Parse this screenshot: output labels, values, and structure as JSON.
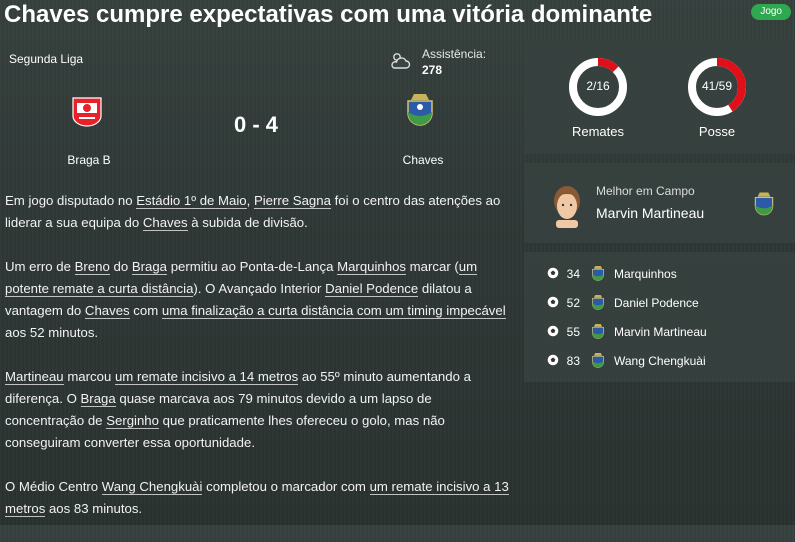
{
  "headline": "Chaves cumpre expectativas com uma vitória dominante",
  "tag": "Jogo",
  "match": {
    "competition": "Segunda Liga",
    "attendance_label": "Assistência:",
    "attendance_value": "278",
    "home_team": "Braga B",
    "away_team": "Chaves",
    "score": "0 - 4",
    "weather_icon": "cloud-icon"
  },
  "article": {
    "p1": [
      {
        "t": "Em jogo disputado no "
      },
      {
        "t": "Estádio 1º de Maio",
        "link": true
      },
      {
        "t": ", "
      },
      {
        "t": "Pierre Sagna",
        "link": true
      },
      {
        "t": " foi o centro das atenções ao liderar a sua equipa do "
      },
      {
        "t": "Chaves",
        "link": true
      },
      {
        "t": " à subida de divisão."
      }
    ],
    "p2": [
      {
        "t": "Um erro de "
      },
      {
        "t": "Breno",
        "link": true
      },
      {
        "t": " do "
      },
      {
        "t": "Braga",
        "link": true
      },
      {
        "t": " permitiu ao Ponta-de-Lança "
      },
      {
        "t": "Marquinhos",
        "link": true
      },
      {
        "t": " marcar ("
      },
      {
        "t": "um potente remate a curta distância",
        "link": true
      },
      {
        "t": "). O Avançado Interior "
      },
      {
        "t": "Daniel Podence",
        "link": true
      },
      {
        "t": " dilatou a vantagem do "
      },
      {
        "t": "Chaves",
        "link": true
      },
      {
        "t": " com "
      },
      {
        "t": "uma finalização a curta distância com um timing impecável",
        "link": true
      },
      {
        "t": " aos 52 minutos."
      }
    ],
    "p3": [
      {
        "t": "Martineau",
        "link": true
      },
      {
        "t": " marcou "
      },
      {
        "t": "um remate incisivo a 14 metros",
        "link": true
      },
      {
        "t": " ao 55º minuto aumentando a diferença. O "
      },
      {
        "t": "Braga",
        "link": true
      },
      {
        "t": " quase marcava aos 79 minutos devido a um lapso de concentração de "
      },
      {
        "t": "Serginho",
        "link": true
      },
      {
        "t": " que praticamente lhes ofereceu o golo, mas não conseguiram converter essa oportunidade."
      }
    ],
    "p4": [
      {
        "t": "O Médio Centro "
      },
      {
        "t": "Wang Chengkuài",
        "link": true
      },
      {
        "t": " completou o marcador com "
      },
      {
        "t": "um remate incisivo a 13 metros",
        "link": true
      },
      {
        "t": " aos 83 minutos."
      }
    ]
  },
  "stats": {
    "shots_label": "Remates",
    "shots_value": "2/16",
    "shots_fraction": 0.125,
    "possession_label": "Posse",
    "possession_value": "41/59",
    "possession_fraction": 0.41,
    "home_color": "#e0101a",
    "away_color": "#ffffff"
  },
  "motm": {
    "label": "Melhor em Campo",
    "name": "Marvin Martineau"
  },
  "goals": [
    {
      "minute": "34",
      "scorer": "Marquinhos"
    },
    {
      "minute": "52",
      "scorer": "Daniel Podence"
    },
    {
      "minute": "55",
      "scorer": "Marvin Martineau"
    },
    {
      "minute": "83",
      "scorer": "Wang Chengkuài"
    }
  ]
}
